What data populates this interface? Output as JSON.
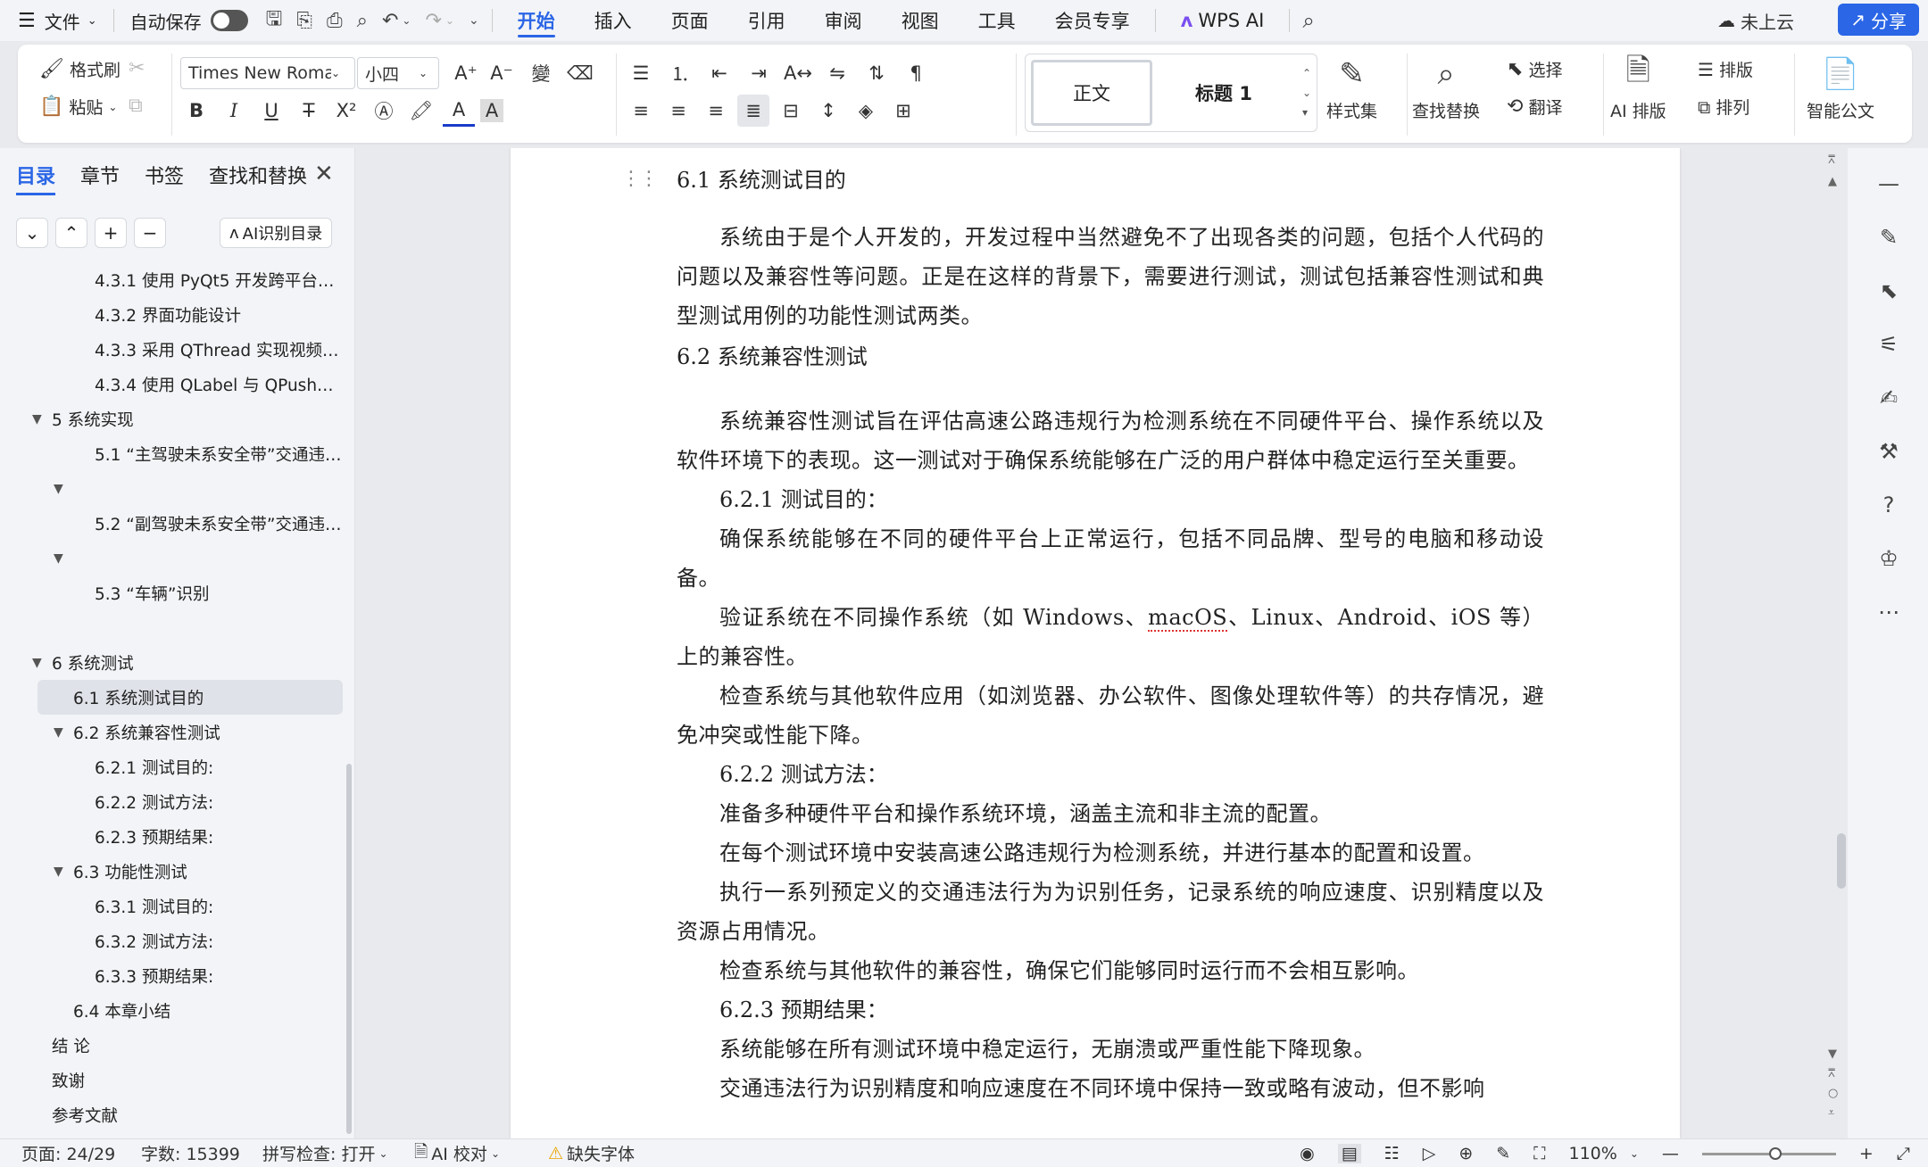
{
  "menubar": {
    "file_label": "文件",
    "autosave_label": "自动保存",
    "tabs": [
      "开始",
      "插入",
      "页面",
      "引用",
      "审阅",
      "视图",
      "工具",
      "会员专享"
    ],
    "wps_ai_label": "WPS AI",
    "cloud_label": "未上云",
    "share_label": "分享"
  },
  "ribbon": {
    "format_painter": "格式刷",
    "paste": "粘贴",
    "font_name": "Times New Roman",
    "font_size": "小四",
    "style_normal": "正文",
    "style_heading": "标题 1",
    "style_set": "样式集",
    "find_replace": "查找替换",
    "select": "选择",
    "translate": "翻译",
    "ai_layout": "AI 排版",
    "layout": "排版",
    "arrange": "排列",
    "smart_doc": "智能公文"
  },
  "nav": {
    "tabs": [
      "目录",
      "章节",
      "书签",
      "查找和替换"
    ],
    "ai_toc_label": "AI识别目录",
    "items": [
      {
        "text": "4.3.1  使用 PyQt5 开发跨平台…",
        "level": 3,
        "arrow": ""
      },
      {
        "text": "4.3.2  界面功能设计",
        "level": 3,
        "arrow": ""
      },
      {
        "text": "4.3.3  采用 QThread 实现视频…",
        "level": 3,
        "arrow": ""
      },
      {
        "text": "4.3.4  使用 QLabel 与 QPush…",
        "level": 3,
        "arrow": ""
      },
      {
        "text": "5 系统实现",
        "level": 1,
        "arrow": "▼"
      },
      {
        "text": "5.1 “主驾驶未系安全带”交通违…",
        "level": 3,
        "arrow": ""
      },
      {
        "text": "",
        "level": 2,
        "arrow": "▼"
      },
      {
        "text": "5.2 “副驾驶未系安全带”交通违…",
        "level": 3,
        "arrow": ""
      },
      {
        "text": "",
        "level": 2,
        "arrow": "▼"
      },
      {
        "text": "5.3  “车辆”识别",
        "level": 3,
        "arrow": ""
      },
      {
        "text": "",
        "level": 0,
        "arrow": ""
      },
      {
        "text": "6  系统测试",
        "level": 1,
        "arrow": "▼"
      },
      {
        "text": "6.1  系统测试目的",
        "level": 2,
        "arrow": "",
        "selected": true
      },
      {
        "text": "6.2  系统兼容性测试",
        "level": 2,
        "arrow": "▼"
      },
      {
        "text": "6.2.1 测试目的:",
        "level": 3,
        "arrow": ""
      },
      {
        "text": "6.2.2 测试方法:",
        "level": 3,
        "arrow": ""
      },
      {
        "text": "6.2.3 预期结果:",
        "level": 3,
        "arrow": ""
      },
      {
        "text": "6.3  功能性测试",
        "level": 2,
        "arrow": "▼"
      },
      {
        "text": "6.3.1 测试目的:",
        "level": 3,
        "arrow": ""
      },
      {
        "text": "6.3.2 测试方法:",
        "level": 3,
        "arrow": ""
      },
      {
        "text": "6.3.3 预期结果:",
        "level": 3,
        "arrow": ""
      },
      {
        "text": "6.4  本章小结",
        "level": 2,
        "arrow": ""
      },
      {
        "text": "结    论",
        "level": 1,
        "arrow": ""
      },
      {
        "text": "致谢",
        "level": 1,
        "arrow": ""
      },
      {
        "text": "参考文献",
        "level": 1,
        "arrow": ""
      }
    ]
  },
  "doc": {
    "h_61": "6.1  系统测试目的",
    "p1": "系统由于是个人开发的，开发过程中当然避免不了出现各类的问题，包括个人代码的问题以及兼容性等问题。正是在这样的背景下，需要进行测试，测试包括兼容性测试和典型测试用例的功能性测试两类。",
    "h_62": "6.2  系统兼容性测试",
    "p2": "系统兼容性测试旨在评估高速公路违规行为检测系统在不同硬件平台、操作系统以及软件环境下的表现。这一测试对于确保系统能够在广泛的用户群体中稳定运行至关重要。",
    "h_621": "6.2.1 测试目的：",
    "p3": "确保系统能够在不同的硬件平台上正常运行，包括不同品牌、型号的电脑和移动设备。",
    "p4_a": "验证系统在不同操作系统（如 Windows、",
    "p4_spell": "macOS",
    "p4_b": "、Linux、Android、iOS 等）上的兼容性。",
    "p5": "检查系统与其他软件应用（如浏览器、办公软件、图像处理软件等）的共存情况，避免冲突或性能下降。",
    "h_622": "6.2.2 测试方法：",
    "p6": "准备多种硬件平台和操作系统环境，涵盖主流和非主流的配置。",
    "p7": "在每个测试环境中安装高速公路违规行为检测系统，并进行基本的配置和设置。",
    "p8": "执行一系列预定义的交通违法行为为识别任务，记录系统的响应速度、识别精度以及资源占用情况。",
    "p9": "检查系统与其他软件的兼容性，确保它们能够同时运行而不会相互影响。",
    "h_623": "6.2.3 预期结果：",
    "p10": "系统能够在所有测试环境中稳定运行，无崩溃或严重性能下降现象。",
    "p11": "交通违法行为识别精度和响应速度在不同环境中保持一致或略有波动，但不影响"
  },
  "status": {
    "page": "页面: 24/29",
    "words": "字数: 15399",
    "spell": "拼写检查: 打开",
    "ai_proof": "AI 校对",
    "missing_font": "缺失字体",
    "zoom": "110%",
    "zoom_level": 0.55
  }
}
